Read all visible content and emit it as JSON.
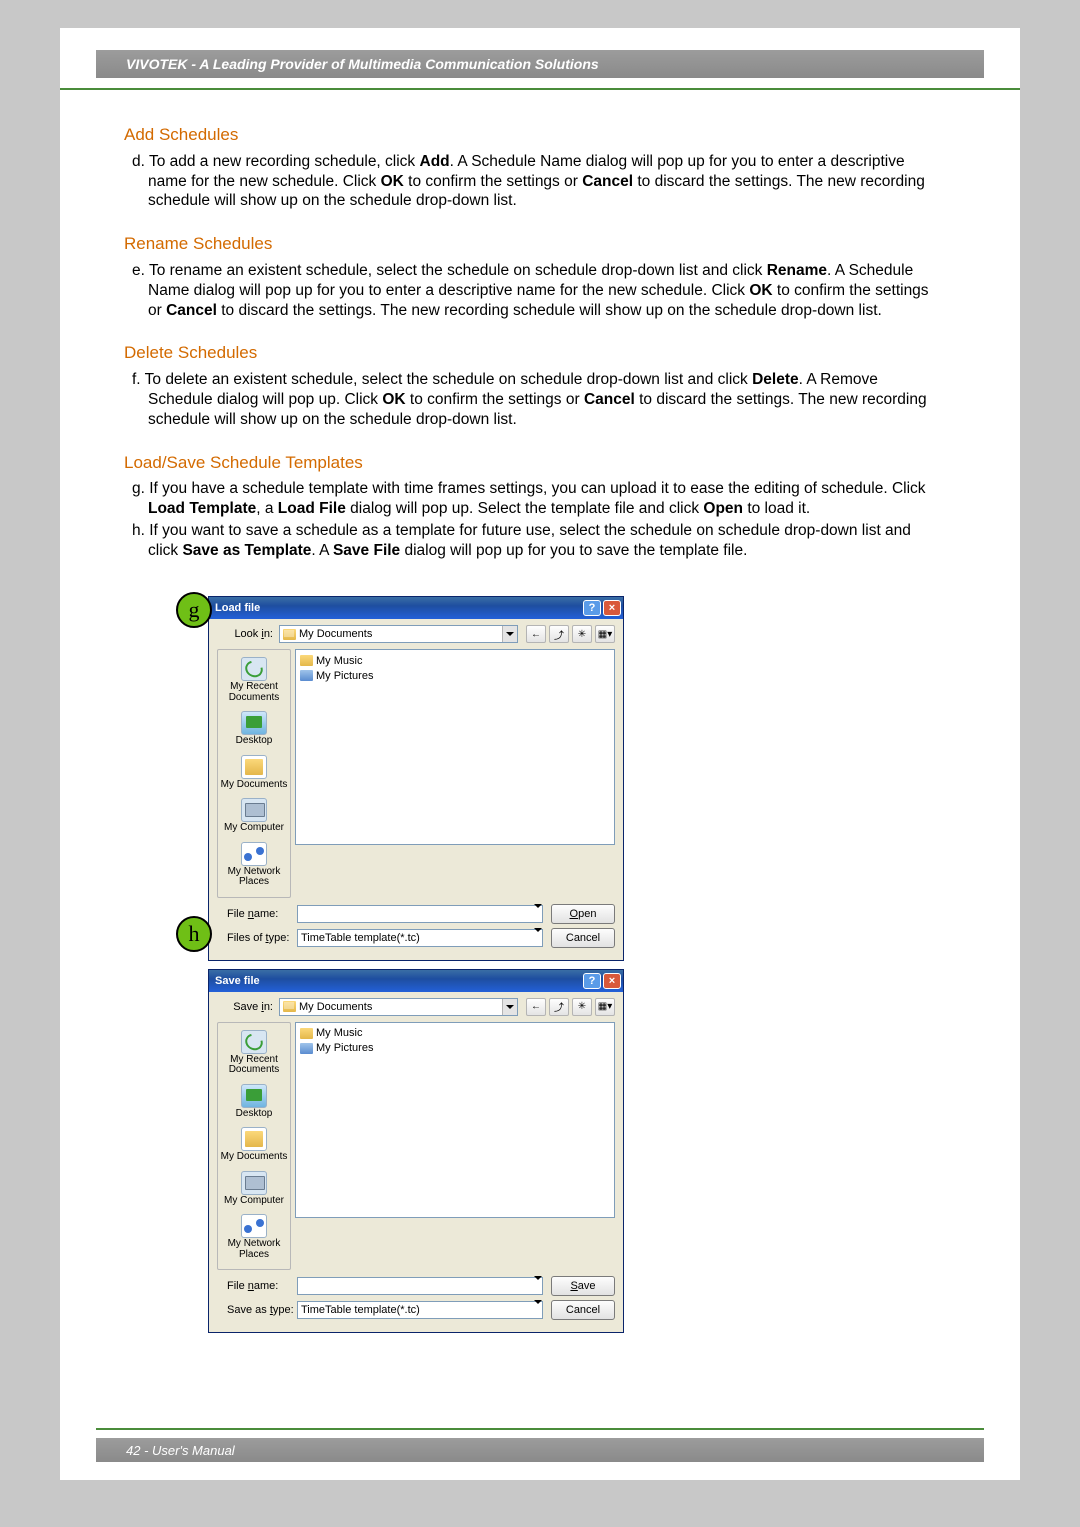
{
  "header": {
    "title": "VIVOTEK - A Leading Provider of Multimedia Communication Solutions"
  },
  "sections": {
    "add": {
      "title": "Add Schedules",
      "body_prefix": "d. To add a new recording schedule, click ",
      "b1": "Add",
      "mid1": ". A Schedule Name dialog will pop up for you to enter a descriptive name for the new schedule. Click ",
      "b2": "OK",
      "mid2": " to confirm the settings or ",
      "b3": "Cancel",
      "end": " to discard the settings. The new recording schedule will show up on the schedule drop-down list."
    },
    "rename": {
      "title": "Rename Schedules",
      "p": "e. To rename an existent schedule, select the schedule on schedule drop-down list and click ",
      "b1": "Rename",
      "mid1": ". A Schedule Name dialog will pop up for you to enter a descriptive name for the new schedule. Click ",
      "b2": "OK",
      "mid2": " to confirm the settings or ",
      "b3": "Cancel",
      "end": " to discard the settings. The new recording schedule will show up on the schedule drop-down list."
    },
    "delete": {
      "title": "Delete Schedules",
      "p": "f. To delete an existent schedule, select the schedule on schedule drop-down list and click ",
      "b1": "Delete",
      "mid1": ". A Remove Schedule dialog will pop up. Click ",
      "b2": "OK",
      "mid2": " to confirm the settings or ",
      "b3": "Cancel",
      "end": " to discard the settings. The new recording schedule will show up on the schedule drop-down list."
    },
    "template": {
      "title": "Load/Save Schedule Templates",
      "g_pre": "g. If you have a schedule template with time frames settings, you can upload it to ease the editing of schedule. Click ",
      "g_b1": "Load Template",
      "g_mid1": ", a ",
      "g_b2": "Load File",
      "g_mid2": " dialog will pop up. Select the template file and click ",
      "g_b3": "Open",
      "g_end": " to load it.",
      "h_pre": "h. If you want to save a schedule as a template for future use, select the schedule on schedule drop-down list and click ",
      "h_b1": "Save as Template",
      "h_mid1": ". A ",
      "h_b2": "Save File",
      "h_end": " dialog will pop up for you to save the template file."
    }
  },
  "callouts": {
    "g": "g",
    "h": "h"
  },
  "dialogs": {
    "load": {
      "title": "Load file",
      "lookin_label": "Look in:",
      "lookin_value": "My Documents",
      "files": [
        "My Music",
        "My Pictures"
      ],
      "places": [
        "My Recent Documents",
        "Desktop",
        "My Documents",
        "My Computer",
        "My Network Places"
      ],
      "filename_label": "File name:",
      "filename_value": "",
      "type_label": "Files of type:",
      "type_value": "TimeTable template(*.tc)",
      "open_btn": "Open",
      "cancel_btn": "Cancel"
    },
    "save": {
      "title": "Save file",
      "savein_label": "Save in:",
      "savein_value": "My Documents",
      "files": [
        "My Music",
        "My Pictures"
      ],
      "places": [
        "My Recent Documents",
        "Desktop",
        "My Documents",
        "My Computer",
        "My Network Places"
      ],
      "filename_label": "File name:",
      "filename_value": "",
      "type_label": "Save as type:",
      "type_value": "TimeTable template(*.tc)",
      "save_btn": "Save",
      "cancel_btn": "Cancel"
    }
  },
  "footer": {
    "text": "42 - User's Manual"
  }
}
